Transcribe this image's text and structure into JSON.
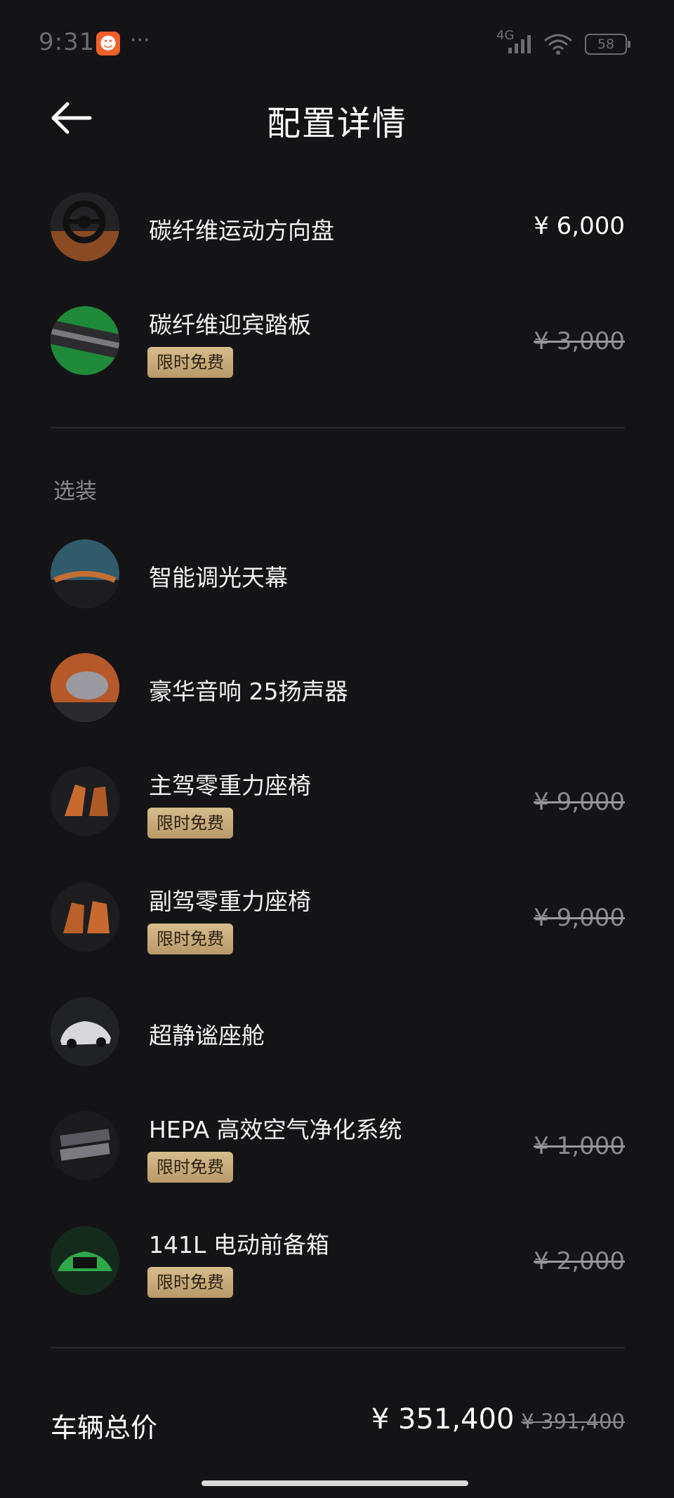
{
  "status_bar": {
    "time": "9:31",
    "network": "4G",
    "battery": "58"
  },
  "header": {
    "title": "配置详情"
  },
  "standard_items": [
    {
      "name": "碳纤维运动方向盘",
      "price": "¥ 6,000"
    },
    {
      "name": "碳纤维迎宾踏板",
      "badge": "限时免费",
      "original_price": "¥ 3,000"
    }
  ],
  "options": {
    "section_label": "选装",
    "items": [
      {
        "name": "智能调光天幕"
      },
      {
        "name": "豪华音响 25扬声器"
      },
      {
        "name": "主驾零重力座椅",
        "badge": "限时免费",
        "original_price": "¥ 9,000"
      },
      {
        "name": "副驾零重力座椅",
        "badge": "限时免费",
        "original_price": "¥ 9,000"
      },
      {
        "name": "超静谧座舱"
      },
      {
        "name": "HEPA 高效空气净化系统",
        "badge": "限时免费",
        "original_price": "¥ 1,000"
      },
      {
        "name": "141L 电动前备箱",
        "badge": "限时免费",
        "original_price": "¥ 2,000"
      }
    ]
  },
  "total": {
    "label": "车辆总价",
    "price": "¥ 351,400",
    "original_price": "¥ 391,400"
  },
  "colors": {
    "background": "#141416",
    "badge_gold": "#c9ab78",
    "muted_text": "#8b8b8f"
  }
}
